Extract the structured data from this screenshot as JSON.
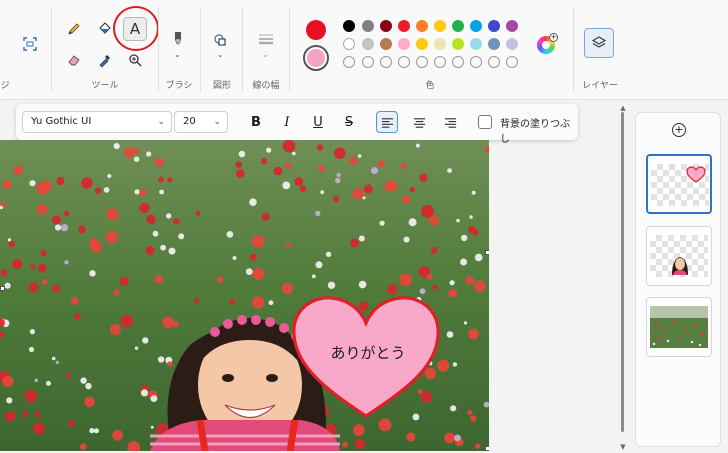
{
  "ribbon": {
    "groups": {
      "image_label": "ジ",
      "tools_label": "ツール",
      "brush_label": "ブラシ",
      "shapes_label": "図形",
      "stroke_label": "線の幅",
      "colors_label": "色",
      "layers_label": "レイヤー"
    },
    "tools": [
      "pencil-icon",
      "fill-icon",
      "text-icon",
      "eraser-icon",
      "color-picker-icon",
      "magnifier-icon"
    ],
    "text_tool_glyph": "A",
    "primary_color": "#e81123",
    "secondary_color": "#f7a1c4",
    "swatches_row1": [
      "#000000",
      "#7f7f7f",
      "#880015",
      "#ed1c24",
      "#ff7f27",
      "#ffc90e",
      "#22b14c",
      "#00a2e8",
      "#3f48cc",
      "#a349a4"
    ],
    "swatches_row2": [
      "#ffffff",
      "#c3c3c3",
      "#b97a57",
      "#ffaec9",
      "#ffc90e",
      "#efe4b0",
      "#b5e61d",
      "#99d9ea",
      "#7092be",
      "#c8bfe7"
    ]
  },
  "text_toolbar": {
    "font_family": "Yu Gothic UI",
    "font_size": "20",
    "bold": "B",
    "italic": "I",
    "underline": "U",
    "strike": "S",
    "fill_background_label": "背景の塗りつぶし"
  },
  "canvas": {
    "heart_text": "ありがとう",
    "heart_color": "#f8a9c9",
    "heart_outline": "#e02028"
  },
  "layers_panel": {
    "add_glyph": "+",
    "layers": [
      "layer-heart",
      "layer-girl",
      "layer-background"
    ]
  }
}
